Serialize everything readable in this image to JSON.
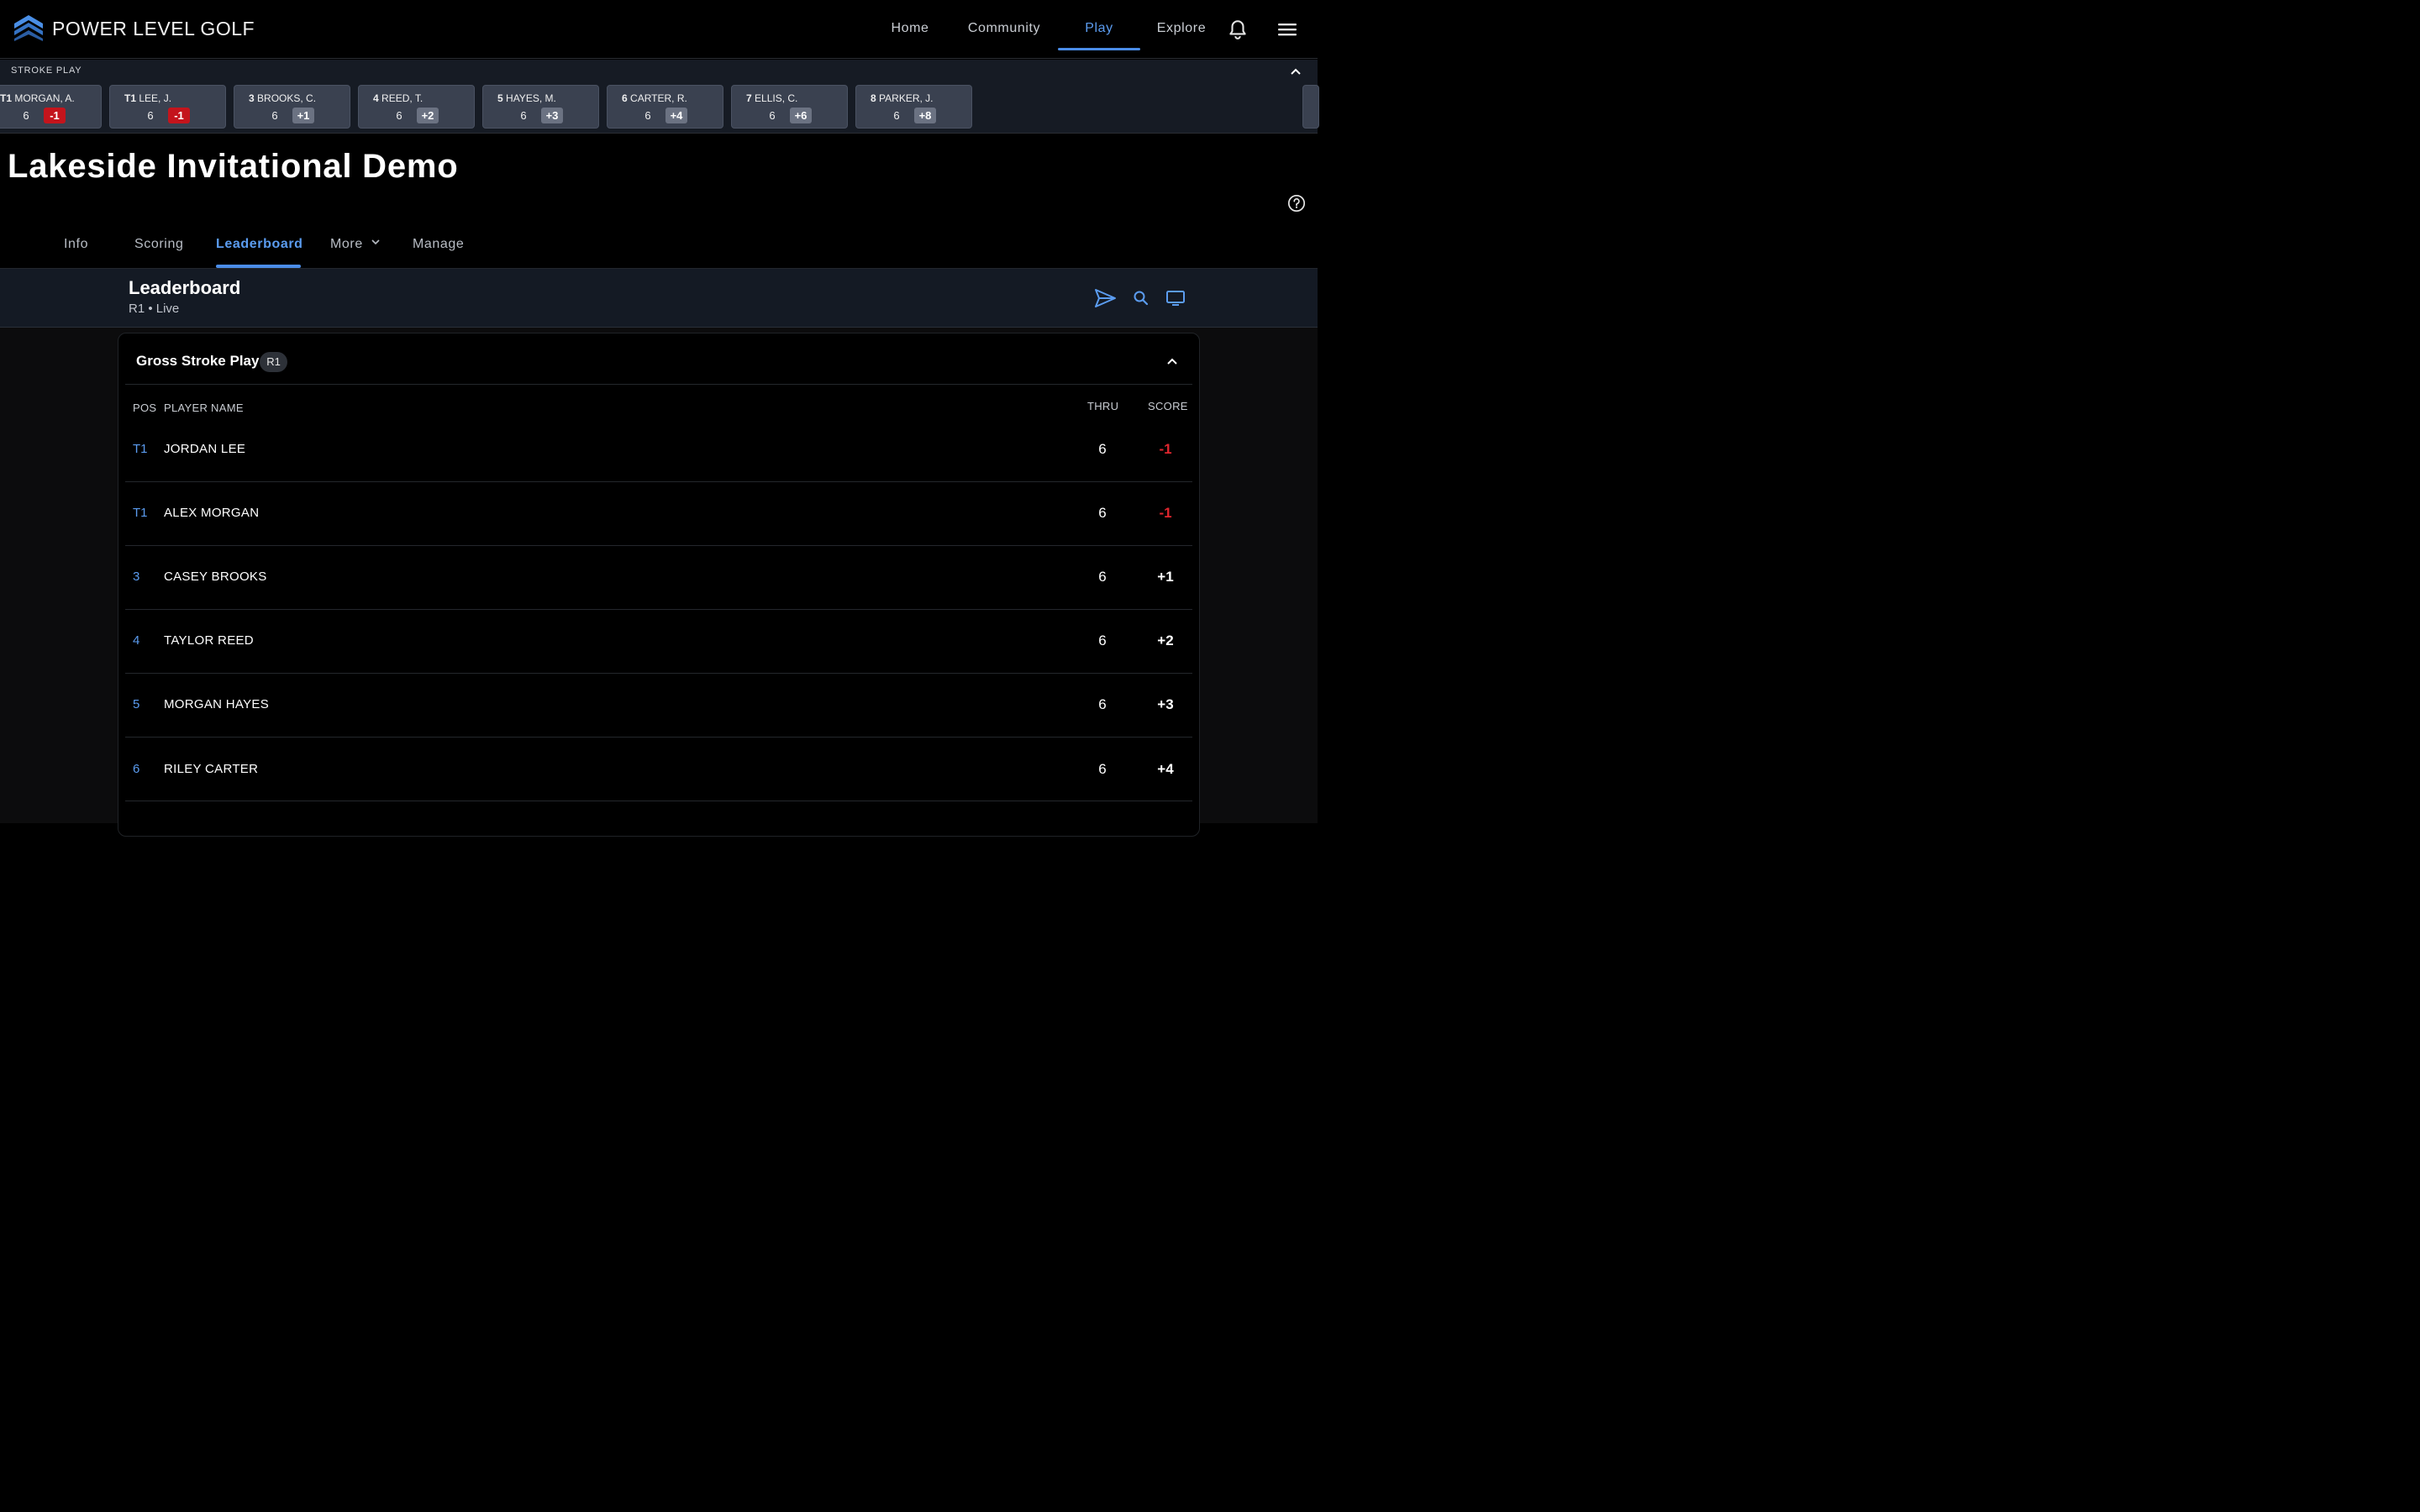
{
  "brand": {
    "name": "POWER LEVEL GOLF",
    "logo_color": "#3f86e0"
  },
  "nav": {
    "items": [
      {
        "label": "Home",
        "active": false
      },
      {
        "label": "Community",
        "active": false
      },
      {
        "label": "Play",
        "active": true
      },
      {
        "label": "Explore",
        "active": false
      }
    ],
    "icons": [
      "bell-icon",
      "hamburger-menu-icon"
    ]
  },
  "ticker": {
    "title": "STROKE PLAY",
    "cards": [
      {
        "pos": "T1",
        "name": "MORGAN, A.",
        "thru": "6",
        "score": "-1",
        "negative": true
      },
      {
        "pos": "T1",
        "name": "LEE, J.",
        "thru": "6",
        "score": "-1",
        "negative": true
      },
      {
        "pos": "3",
        "name": "BROOKS, C.",
        "thru": "6",
        "score": "+1",
        "negative": false
      },
      {
        "pos": "4",
        "name": "REED, T.",
        "thru": "6",
        "score": "+2",
        "negative": false
      },
      {
        "pos": "5",
        "name": "HAYES, M.",
        "thru": "6",
        "score": "+3",
        "negative": false
      },
      {
        "pos": "6",
        "name": "CARTER, R.",
        "thru": "6",
        "score": "+4",
        "negative": false
      },
      {
        "pos": "7",
        "name": "ELLIS, C.",
        "thru": "6",
        "score": "+6",
        "negative": false
      },
      {
        "pos": "8",
        "name": "PARKER, J.",
        "thru": "6",
        "score": "+8",
        "negative": false
      }
    ]
  },
  "event": {
    "title": "Lakeside Invitational Demo"
  },
  "tabs": [
    {
      "label": "Info",
      "active": false
    },
    {
      "label": "Scoring",
      "active": false
    },
    {
      "label": "Leaderboard",
      "active": true
    },
    {
      "label": "More",
      "active": false
    },
    {
      "label": "Manage",
      "active": false
    }
  ],
  "section": {
    "title": "Leaderboard",
    "subtitle": "R1 • Live",
    "icons": [
      "send-icon",
      "search-icon",
      "tv-icon"
    ]
  },
  "panel": {
    "title": "Gross Stroke Play",
    "round_badge": "R1",
    "columns": {
      "pos": "POS",
      "name": "PLAYER NAME",
      "thru": "THRU",
      "score": "SCORE"
    },
    "rows": [
      {
        "pos": "T1",
        "name": "JORDAN LEE",
        "thru": "6",
        "score": "-1",
        "negative": true
      },
      {
        "pos": "T1",
        "name": "ALEX MORGAN",
        "thru": "6",
        "score": "-1",
        "negative": true
      },
      {
        "pos": "3",
        "name": "CASEY BROOKS",
        "thru": "6",
        "score": "+1",
        "negative": false
      },
      {
        "pos": "4",
        "name": "TAYLOR REED",
        "thru": "6",
        "score": "+2",
        "negative": false
      },
      {
        "pos": "5",
        "name": "MORGAN HAYES",
        "thru": "6",
        "score": "+3",
        "negative": false
      },
      {
        "pos": "6",
        "name": "RILEY CARTER",
        "thru": "6",
        "score": "+4",
        "negative": false
      }
    ]
  },
  "colors": {
    "accent": "#4b8de8",
    "negative": "#e0262e",
    "negative_badge": "#c4141c"
  }
}
